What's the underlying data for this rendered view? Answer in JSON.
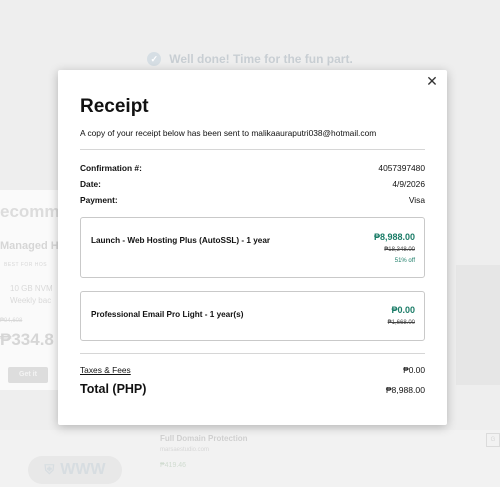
{
  "background": {
    "banner": "Well done! Time for the fun part.",
    "card_title": "ecomm",
    "plan_name": "Managed H",
    "plan_badge": "BEST FOR HOS",
    "features": [
      "10 GB NVM",
      "Weekly bac"
    ],
    "strike_price": "₱94,608",
    "price": "₱334.8",
    "cta": "Get it",
    "domain_logo": "WWW",
    "protection_title": "Full Domain Protection",
    "protection_domain": "marsaestudio.com",
    "protection_price": "₱419.46"
  },
  "modal": {
    "title": "Receipt",
    "subtitle": "A copy of your receipt below has been sent to malikaauraputri038@hotmail.com",
    "confirmation_label": "Confirmation #:",
    "confirmation_value": "4057397480",
    "date_label": "Date:",
    "date_value": "4/9/2026",
    "payment_label": "Payment:",
    "payment_value": "Visa",
    "items": [
      {
        "name": "Launch - Web Hosting Plus (AutoSSL) - 1 year",
        "price": "₱8,988.00",
        "original_price": "₱18,348.00",
        "discount": "51% off"
      },
      {
        "name": "Professional Email Pro Light - 1 year(s)",
        "price": "₱0.00",
        "original_price": "₱1,668.00"
      }
    ],
    "taxes_label": "Taxes & Fees",
    "taxes_value": "₱0.00",
    "total_label": "Total (PHP)",
    "total_value": "₱8,988.00"
  },
  "colors": {
    "accent_green": "#1a7c67"
  }
}
